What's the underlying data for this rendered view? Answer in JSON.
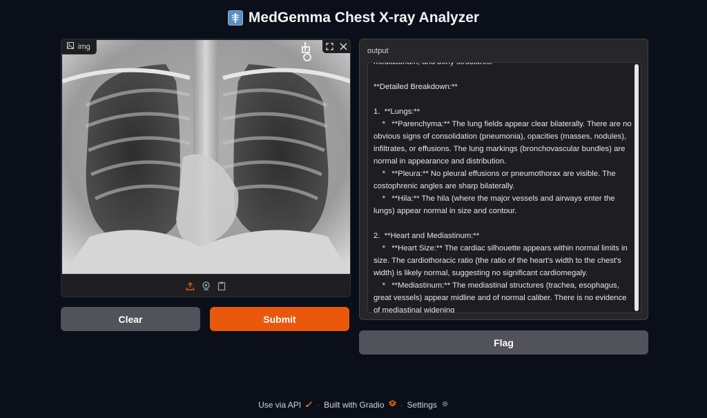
{
  "app": {
    "title": "MedGemma Chest X-ray Analyzer"
  },
  "image_input": {
    "label": "img",
    "icons": [
      "fullscreen-icon",
      "close-icon"
    ],
    "sources": [
      "upload-icon",
      "webcam-icon",
      "clipboard-icon"
    ]
  },
  "buttons": {
    "clear": "Clear",
    "submit": "Submit",
    "flag": "Flag"
  },
  "output": {
    "label": "output",
    "text": "mediastinum, and bony structures.\n\n**Detailed Breakdown:**\n\n1.  **Lungs:**\n    *   **Parenchyma:** The lung fields appear clear bilaterally. There are no obvious signs of consolidation (pneumonia), opacities (masses, nodules), infiltrates, or effusions. The lung markings (bronchovascular bundles) are normal in appearance and distribution.\n    *   **Pleura:** No pleural effusions or pneumothorax are visible. The costophrenic angles are sharp bilaterally.\n    *   **Hila:** The hila (where the major vessels and airways enter the lungs) appear normal in size and contour.\n\n2.  **Heart and Mediastinum:**\n    *   **Heart Size:** The cardiac silhouette appears within normal limits in size. The cardiothoracic ratio (the ratio of the heart's width to the chest's width) is likely normal, suggesting no significant cardiomegaly.\n    *   **Mediastinum:** The mediastinal structures (trachea, esophagus, great vessels) appear midline and of normal caliber. There is no evidence of mediastinal widening"
  },
  "footer": {
    "api": "Use via API",
    "built": "Built with Gradio",
    "settings": "Settings",
    "separator": "·"
  },
  "colors": {
    "accent": "#ea580c",
    "background": "#0b0f19"
  }
}
